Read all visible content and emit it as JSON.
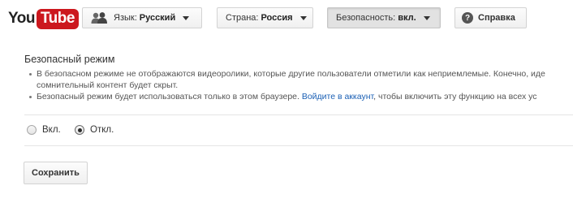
{
  "logo": {
    "you": "You",
    "tube": "Tube"
  },
  "header": {
    "language": {
      "label": "Язык:",
      "value": "Русский"
    },
    "country": {
      "label": "Страна:",
      "value": "Россия"
    },
    "safety": {
      "label": "Безопасность:",
      "value": "вкл."
    },
    "help": {
      "icon_glyph": "?",
      "label": "Справка"
    }
  },
  "safety_mode": {
    "title": "Безопасный режим",
    "bullet1_line1": "В безопасном режиме не отображаются видеоролики, которые другие пользователи отметили как неприемлемые. Конечно, иде",
    "bullet1_line2": "сомнительный контент будет скрыт.",
    "bullet2_before": "Безопасный режим будет использоваться только в этом браузере. ",
    "bullet2_link": "Войдите в аккаунт",
    "bullet2_after": ", чтобы включить эту функцию на всех ус",
    "options": [
      {
        "label": "Вкл.",
        "selected": false
      },
      {
        "label": "Откл.",
        "selected": true
      }
    ],
    "save_label": "Сохранить"
  },
  "colors": {
    "brand_red": "#cc181e",
    "link": "#1a5fb4"
  },
  "icons": {
    "language": "people-icon",
    "help": "help-icon",
    "dropdown": "caret-down-icon"
  }
}
